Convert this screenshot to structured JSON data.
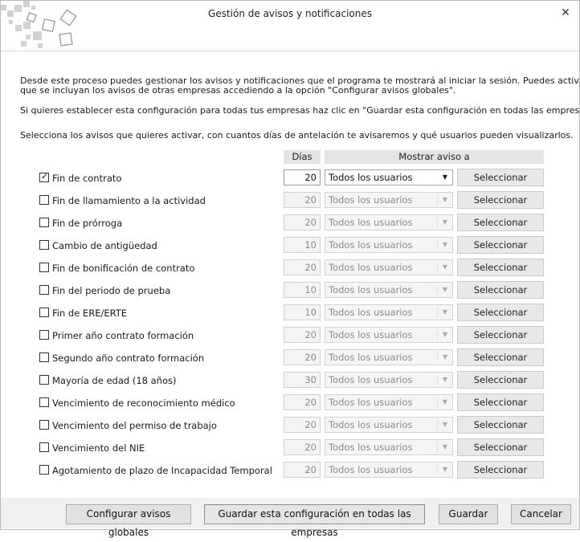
{
  "window": {
    "title": "Gestión de avisos y notificaciones",
    "close_glyph": "✕"
  },
  "intro": {
    "line1": "Desde este proceso puedes gestionar los avisos y notificaciones que el programa te mostrará al iniciar la sesión. Puedes activar",
    "line2": "que se incluyan los avisos de otras empresas accediendo a la opción \"Configurar avisos globales\".",
    "line3": "Si quieres establecer esta configuración para todas tus empresas haz clic en \"Guardar esta configuración en todas las empresas\".",
    "line4": "Selecciona los avisos que quieres activar, con cuantos días de antelación te avisaremos y qué usuarios pueden visualizarlos."
  },
  "table": {
    "col_days": "Días",
    "col_show": "Mostrar aviso a",
    "rows": [
      {
        "label": "Fin de contrato",
        "checked": true,
        "days": "20",
        "users": "Todos los usuarios",
        "button": "Seleccionar"
      },
      {
        "label": "Fin de llamamiento a la actividad",
        "checked": false,
        "days": "20",
        "users": "Todos los usuarios",
        "button": "Seleccionar"
      },
      {
        "label": "Fin de prórroga",
        "checked": false,
        "days": "20",
        "users": "Todos los usuarios",
        "button": "Seleccionar"
      },
      {
        "label": "Cambio de antigüedad",
        "checked": false,
        "days": "10",
        "users": "Todos los usuarios",
        "button": "Seleccionar"
      },
      {
        "label": "Fin de bonificación de contrato",
        "checked": false,
        "days": "20",
        "users": "Todos los usuarios",
        "button": "Seleccionar"
      },
      {
        "label": "Fin del periodo de prueba",
        "checked": false,
        "days": "10",
        "users": "Todos los usuarios",
        "button": "Seleccionar"
      },
      {
        "label": "Fin de ERE/ERTE",
        "checked": false,
        "days": "10",
        "users": "Todos los usuarios",
        "button": "Seleccionar"
      },
      {
        "label": "Primer año contrato formación",
        "checked": false,
        "days": "20",
        "users": "Todos los usuarios",
        "button": "Seleccionar"
      },
      {
        "label": "Segundo año contrato formación",
        "checked": false,
        "days": "20",
        "users": "Todos los usuarios",
        "button": "Seleccionar"
      },
      {
        "label": "Mayoría de edad (18 años)",
        "checked": false,
        "days": "30",
        "users": "Todos los usuarios",
        "button": "Seleccionar"
      },
      {
        "label": "Vencimiento de reconocimiento médico",
        "checked": false,
        "days": "20",
        "users": "Todos los usuarios",
        "button": "Seleccionar"
      },
      {
        "label": "Vencimiento del permiso de trabajo",
        "checked": false,
        "days": "20",
        "users": "Todos los usuarios",
        "button": "Seleccionar"
      },
      {
        "label": "Vencimiento del NIE",
        "checked": false,
        "days": "20",
        "users": "Todos los usuarios",
        "button": "Seleccionar"
      },
      {
        "label": "Agotamiento de plazo de Incapacidad Temporal",
        "checked": false,
        "days": "20",
        "users": "Todos los usuarios",
        "button": "Seleccionar"
      }
    ]
  },
  "footer": {
    "global_button": "Configurar avisos globales",
    "save_all_button": "Guardar esta configuración en todas las empresas",
    "save_button": "Guardar",
    "cancel_button": "Cancelar"
  },
  "icons": {
    "checkbox_tick": "✓",
    "dropdown_arrow": "▼",
    "logo": "squares-logo-icon"
  }
}
